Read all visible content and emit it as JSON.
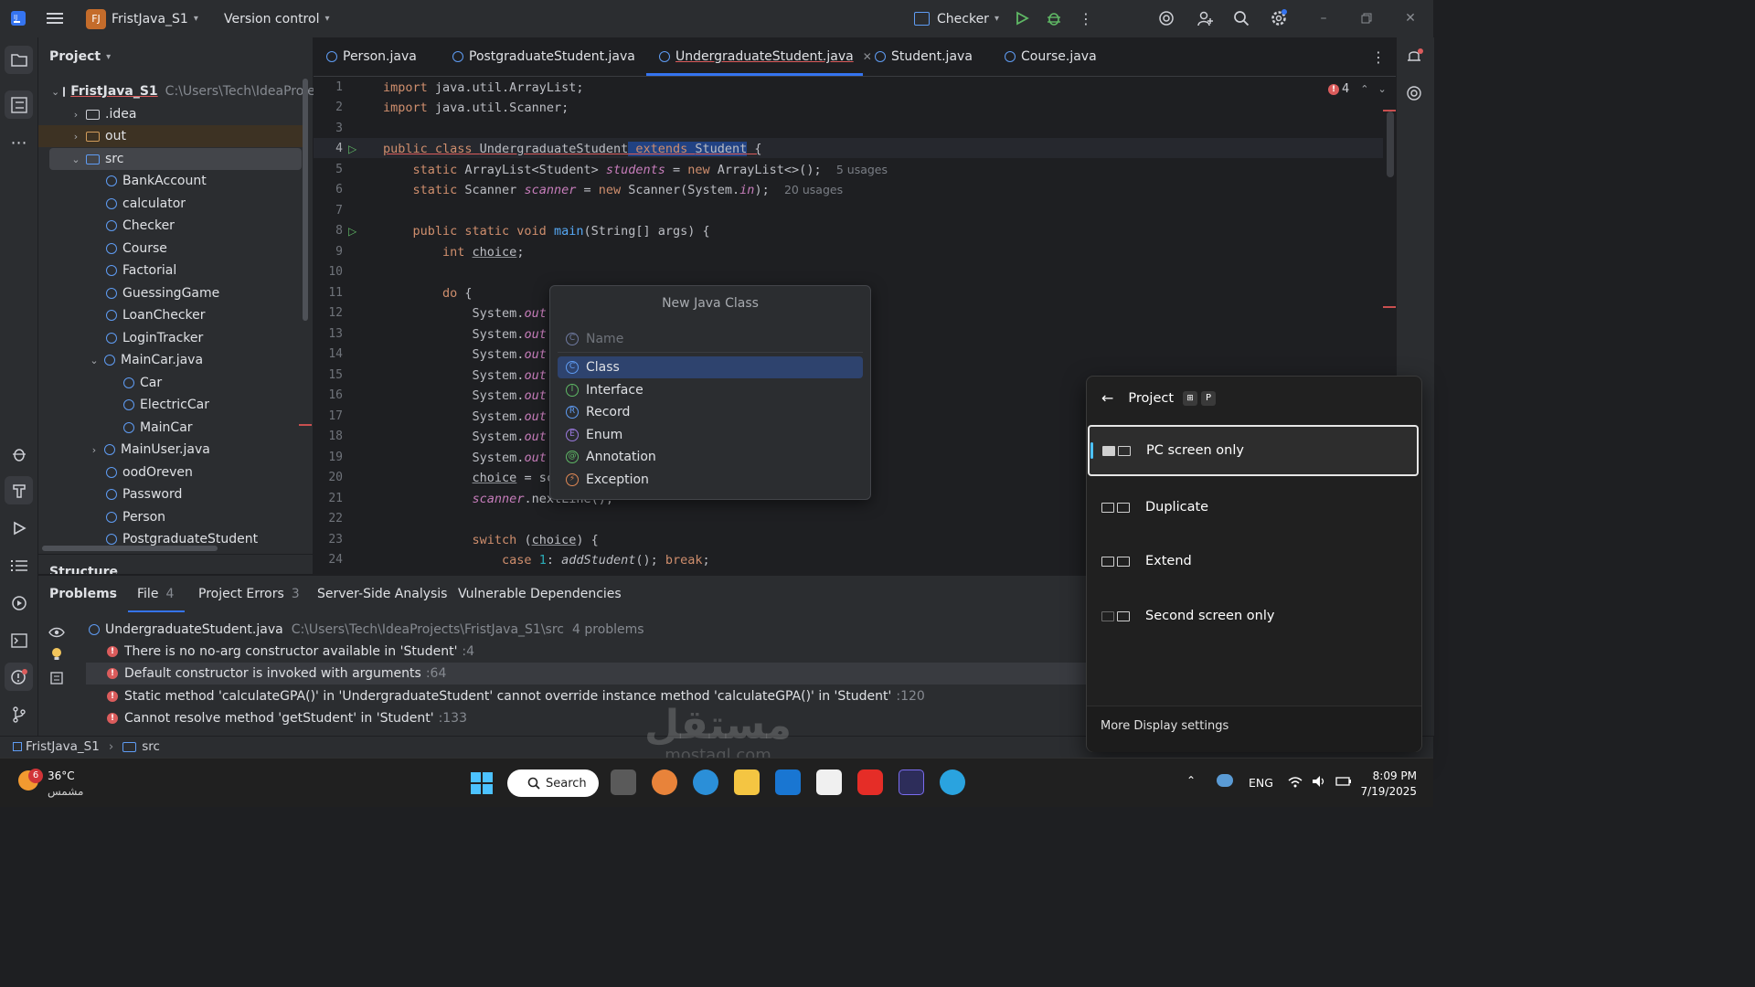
{
  "titlebar": {
    "project_badge": "FJ",
    "project_name": "FristJava_S1",
    "vcs": "Version control",
    "run_config": "Checker"
  },
  "project_panel": {
    "title": "Project",
    "root": "FristJava_S1",
    "root_path": "C:\\Users\\Tech\\IdeaProje",
    "items": [
      {
        "label": ".idea"
      },
      {
        "label": "out"
      },
      {
        "label": "src"
      },
      {
        "label": "BankAccount"
      },
      {
        "label": "calculator"
      },
      {
        "label": "Checker"
      },
      {
        "label": "Course"
      },
      {
        "label": "Factorial"
      },
      {
        "label": "GuessingGame"
      },
      {
        "label": "LoanChecker"
      },
      {
        "label": "LoginTracker"
      },
      {
        "label": "MainCar.java"
      },
      {
        "label": "Car"
      },
      {
        "label": "ElectricCar"
      },
      {
        "label": "MainCar"
      },
      {
        "label": "MainUser.java"
      },
      {
        "label": "oodOreven"
      },
      {
        "label": "Password"
      },
      {
        "label": "Person"
      },
      {
        "label": "PostgraduateStudent"
      }
    ],
    "structure_label": "Structure"
  },
  "tabs": [
    {
      "label": "Person.java"
    },
    {
      "label": "PostgraduateStudent.java"
    },
    {
      "label": "UndergraduateStudent.java"
    },
    {
      "label": "Student.java"
    },
    {
      "label": "Course.java"
    }
  ],
  "editor": {
    "error_count": "4",
    "line_numbers": [
      "1",
      "2",
      "3",
      "4",
      "5",
      "6",
      "7",
      "8",
      "9",
      "10",
      "11",
      "12",
      "13",
      "14",
      "15",
      "16",
      "17",
      "18",
      "19",
      "20",
      "21",
      "22",
      "23",
      "24"
    ],
    "lines": {
      "l1a": "import",
      "l1b": " java.util.ArrayList;",
      "l2a": "import",
      "l2b": " java.util.Scanner;",
      "l4a": "public class ",
      "l4b": "UndergraduateStudent",
      "l4c": " extends ",
      "l4d": "Student",
      "l4e": " {",
      "l5a": "    static ",
      "l5b": "ArrayList<Student> ",
      "l5c": "students",
      "l5d": " = ",
      "l5e": "new ",
      "l5f": "ArrayList<>();",
      "l5hint": "5 usages",
      "l6a": "    static ",
      "l6b": "Scanner ",
      "l6c": "scanner",
      "l6d": " = ",
      "l6e": "new ",
      "l6f": "Scanner(System.",
      "l6g": "in",
      "l6h": ");",
      "l6hint": "20 usages",
      "l8a": "    public static void ",
      "l8b": "main",
      "l8c": "(String[] args) {",
      "l9a": "        int ",
      "l9b": "choice",
      "l9c": ";",
      "l11a": "        do",
      "l11b": " {",
      "sys": "            System.",
      "out": "out",
      "l20a": "            ",
      "l20b": "choice",
      "l20c": " = sc",
      "l21a": "            ",
      "l21b": "scanner",
      "l21c": ".nextLine();",
      "l23a": "            switch",
      "l23b": " (",
      "l23c": "choice",
      "l23d": ") {",
      "l24a": "                case ",
      "l24b": "1",
      "l24c": ": ",
      "l24d": "addStudent",
      "l24e": "(); ",
      "l24f": "break",
      "l24g": ";"
    }
  },
  "popup": {
    "title": "New Java Class",
    "placeholder": "Name",
    "items": [
      {
        "label": "Class",
        "glyph": "C"
      },
      {
        "label": "Interface",
        "glyph": "I"
      },
      {
        "label": "Record",
        "glyph": "R"
      },
      {
        "label": "Enum",
        "glyph": "E"
      },
      {
        "label": "Annotation",
        "glyph": "@"
      },
      {
        "label": "Exception",
        "glyph": "⚡"
      }
    ]
  },
  "problems": {
    "tabs": [
      {
        "label": "Problems"
      },
      {
        "label": "File",
        "count": "4"
      },
      {
        "label": "Project Errors",
        "count": "3"
      },
      {
        "label": "Server-Side Analysis"
      },
      {
        "label": "Vulnerable Dependencies"
      }
    ],
    "file": "UndergraduateStudent.java",
    "file_path": "C:\\Users\\Tech\\IdeaProjects\\FristJava_S1\\src",
    "file_count": "4 problems",
    "items": [
      {
        "text": "There is no no-arg constructor available in 'Student'",
        "line": ":4"
      },
      {
        "text": "Default constructor is invoked with arguments",
        "line": ":64"
      },
      {
        "text": "Static method 'calculateGPA()' in 'UndergraduateStudent' cannot override instance method 'calculateGPA()' in 'Student'",
        "line": ":120"
      },
      {
        "text": "Cannot resolve method 'getStudent' in 'Student'",
        "line": ":133"
      }
    ]
  },
  "statusbar": {
    "crumb1": "FristJava_S1",
    "crumb2": "src"
  },
  "display_flyout": {
    "title": "Project",
    "shortcut_key": "P",
    "options": [
      {
        "label": "PC screen only"
      },
      {
        "label": "Duplicate"
      },
      {
        "label": "Extend"
      },
      {
        "label": "Second screen only"
      }
    ],
    "more": "More Display settings"
  },
  "taskbar": {
    "weather_temp": "36°C",
    "weather_desc": "مشمس",
    "weather_badge": "6",
    "search": "Search",
    "lang": "ENG",
    "time": "8:09 PM",
    "date": "7/19/2025",
    "watermark": "mostaql.com",
    "watermark_ar": "مستقل"
  },
  "colors": {
    "accent": "#3574f0",
    "error": "#db5c5c",
    "ide_bg": "#1e1f22",
    "panel_bg": "#2b2d30"
  }
}
